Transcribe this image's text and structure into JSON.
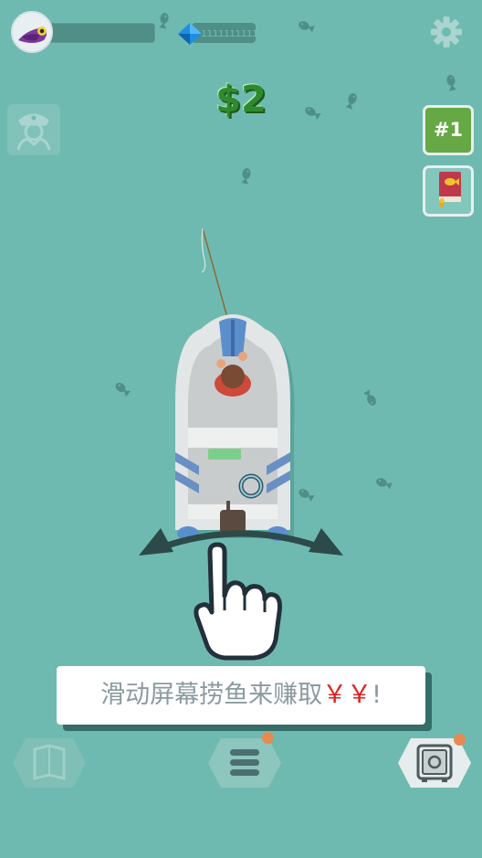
{
  "hud": {
    "avatar_icon": "purple-bird-avatar-icon",
    "xp_bar_fill": 0,
    "gem_icon": "blue-diamond-icon",
    "gem_bar_text": "ıııııııııı",
    "settings_icon": "gear-icon"
  },
  "money": {
    "value": "$2"
  },
  "left_panel": {
    "captain_icon": "captain-icon"
  },
  "right_panel": {
    "rank_label": "#1",
    "book_icon": "fish-book-icon"
  },
  "tutorial": {
    "hint_main": "滑动屏幕捞鱼来赚取",
    "hint_currency": "￥￥",
    "hint_end": "!",
    "hand_icon": "pointing-hand-icon",
    "swipe_arrows_icon": "curved-double-arrow-icon"
  },
  "bottom_bar": {
    "map_icon": "map-icon",
    "menu_icon": "menu-icon",
    "safe_icon": "safe-icon",
    "menu_has_notification": true,
    "safe_has_notification": true
  },
  "colors": {
    "water": "#6fbab0",
    "money_green": "#2f8a2f",
    "rank_green": "#65a844",
    "accent_red": "#e02020",
    "notification_orange": "#e58a52"
  }
}
